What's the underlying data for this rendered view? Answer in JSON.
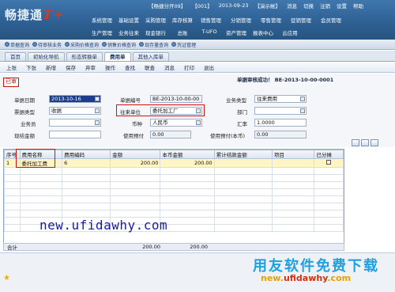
{
  "header": {
    "logo_text": "畅捷通",
    "logo_mark": "T+",
    "top_info": [
      "【畅捷分开09】",
      "【001】",
      "2013-09-23",
      "【演示帐】",
      "消息",
      "切换",
      "注销",
      "设置",
      "帮助"
    ],
    "menu_row1": [
      "系统管理",
      "基础设置",
      "采购管理",
      "库存核算",
      "销售管理",
      "分销管理",
      "零售管理",
      "促销管理",
      "会员管理"
    ],
    "menu_row2": [
      "生产管理",
      "业务往来",
      "现金银行",
      "总账",
      "T-UFO",
      "资产管理",
      "报表中心",
      "云应用"
    ]
  },
  "quick_bar": [
    "单据查询",
    "待审核业务",
    "采购价格查询",
    "销售价格查询",
    "现存量查询",
    "凭证管理"
  ],
  "tabs": [
    "首页",
    "初始化导航",
    "形态转换单",
    "费用单",
    "其他入库单"
  ],
  "active_tab": "费用单",
  "toolbar": [
    "上张",
    "下张",
    "新增",
    "保存",
    "弃审",
    "操作",
    "查找",
    "联查",
    "消息",
    "打印",
    "退出"
  ],
  "status_stamp": "已审",
  "banner": "单据审核成功！ BE-2013-10-00-0001",
  "form": {
    "date_label": "单据日期",
    "date_value": "2013-10-16",
    "no_label": "单据编号",
    "no_value": "BE-2013-10-00-00",
    "biztype_label": "业务类型",
    "biztype_value": "往来费用",
    "billtype_label": "票据类型",
    "billtype_value": "收据",
    "partner_label": "往来单位",
    "partner_value": "委托加工厂",
    "dept_label": "部门",
    "dept_value": "",
    "staff_label": "业务员",
    "staff_value": "",
    "currency_label": "币种",
    "currency_value": "人民币",
    "rate_label": "汇率",
    "rate_value": "1.0000",
    "cash_label": "现结金额",
    "cash_value": "",
    "prepay_label": "使用预付",
    "prepay_value": "0.00",
    "prepay_base_label": "使用预付(本币)",
    "prepay_base_value": "0.00"
  },
  "grid": {
    "headers": [
      "序号",
      "费用名称",
      "费用编码",
      "金额",
      "本币金额",
      "累计结款金额",
      "项目",
      "已分摊"
    ],
    "rows": [
      {
        "no": "1",
        "name": "委托加工费",
        "code": "6",
        "amount": "200.00",
        "base": "200.00",
        "paid": "",
        "project": ""
      }
    ],
    "empty_rows": 9
  },
  "totals": {
    "label": "合计",
    "amount": "200.00",
    "base": "200.00"
  },
  "watermark": {
    "url": "new.ufidawhy.com",
    "cn": "用友软件免费下载",
    "url2_part1": "new.",
    "url2_part2": "ufidawhy",
    "url2_part3": ".com"
  }
}
